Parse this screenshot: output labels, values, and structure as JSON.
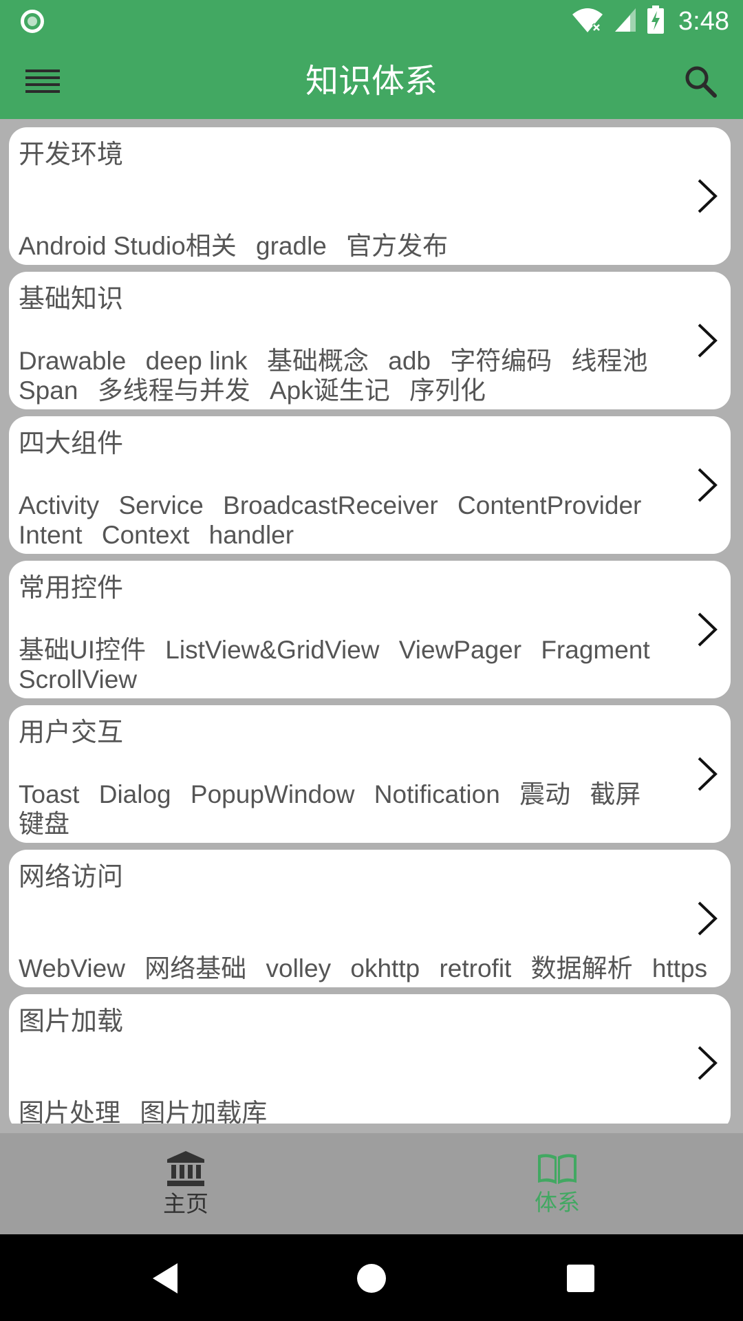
{
  "status_bar": {
    "time": "3:48",
    "icons": [
      "notification-dot-icon",
      "wifi-icon",
      "signal-icon",
      "battery-charging-icon"
    ]
  },
  "app_bar": {
    "title": "知识体系",
    "menu_icon": "menu-icon",
    "search_icon": "search-icon"
  },
  "categories": [
    {
      "title": "开发环境",
      "tags": [
        "Android Studio相关",
        "gradle",
        "官方发布"
      ]
    },
    {
      "title": "基础知识",
      "tags": [
        "Drawable",
        "deep link",
        "基础概念",
        "adb",
        "字符编码",
        "线程池",
        "Span",
        "多线程与并发",
        "Apk诞生记",
        "序列化"
      ]
    },
    {
      "title": "四大组件",
      "tags": [
        "Activity",
        "Service",
        "BroadcastReceiver",
        "ContentProvider",
        "Intent",
        "Context",
        "handler"
      ]
    },
    {
      "title": "常用控件",
      "tags": [
        "基础UI控件",
        "ListView&GridView",
        "ViewPager",
        "Fragment",
        "ScrollView"
      ]
    },
    {
      "title": "用户交互",
      "tags": [
        "Toast",
        "Dialog",
        "PopupWindow",
        "Notification",
        "震动",
        "截屏",
        "键盘"
      ]
    },
    {
      "title": "网络访问",
      "tags": [
        "WebView",
        "网络基础",
        "volley",
        "okhttp",
        "retrofit",
        "数据解析",
        "https"
      ]
    },
    {
      "title": "图片加载",
      "tags": [
        "图片处理",
        "图片加载库"
      ]
    }
  ],
  "bottom_nav": {
    "items": [
      {
        "label": "主页",
        "icon": "bank-icon",
        "active": false
      },
      {
        "label": "体系",
        "icon": "book-icon",
        "active": true
      }
    ],
    "active_color": "#42a862"
  },
  "colors": {
    "primary": "#42a862",
    "background": "#b0b0b0",
    "card": "#ffffff",
    "text": "#555555"
  }
}
